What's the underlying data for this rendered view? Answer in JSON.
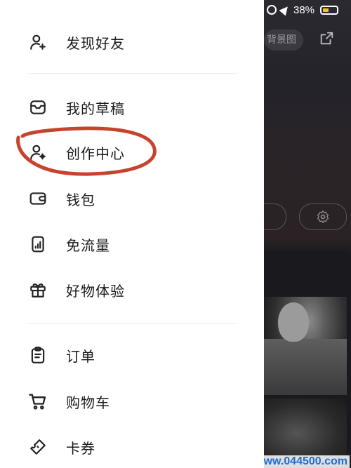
{
  "status_bar": {
    "battery": "38%"
  },
  "background": {
    "pill_label": "背景图",
    "watermark": "www.044500.com"
  },
  "menu": {
    "items": [
      {
        "label": "发现好友",
        "icon": "add-person-icon"
      },
      {
        "label": "我的草稿",
        "icon": "drafts-tray-icon"
      },
      {
        "label": "创作中心",
        "icon": "creator-person-icon"
      },
      {
        "label": "钱包",
        "icon": "wallet-icon"
      },
      {
        "label": "免流量",
        "icon": "data-free-icon"
      },
      {
        "label": "好物体验",
        "icon": "gift-icon"
      },
      {
        "label": "订单",
        "icon": "clipboard-icon"
      },
      {
        "label": "购物车",
        "icon": "cart-icon"
      },
      {
        "label": "卡券",
        "icon": "coupon-icon"
      }
    ]
  },
  "colors": {
    "annotation": "#c8432e",
    "battery": "#f5c518",
    "watermark": "#1e6fd6"
  }
}
